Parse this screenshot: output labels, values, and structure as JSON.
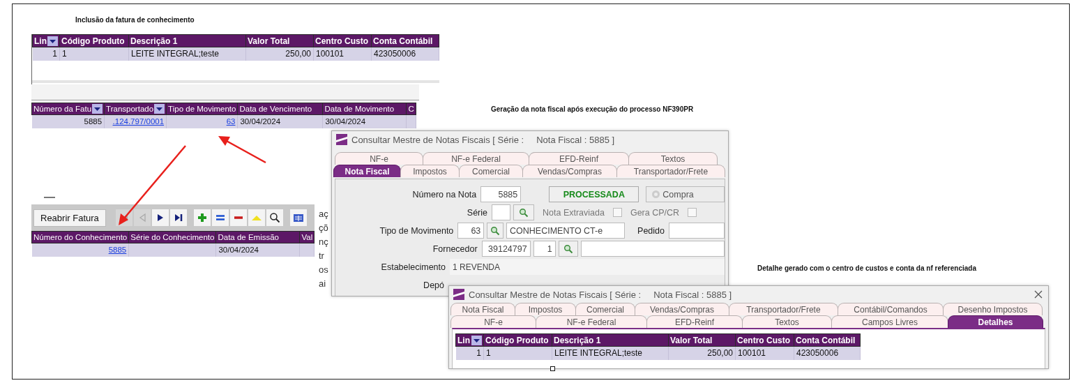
{
  "fatura_items": {
    "caption": "Inclusão da fatura de conhecimento",
    "columns": [
      {
        "label": "Lin",
        "dropdown": true
      },
      {
        "label": "Código Produto",
        "dropdown": false
      },
      {
        "label": "Descrição 1",
        "dropdown": false
      },
      {
        "label": "Valor Total",
        "dropdown": false
      },
      {
        "label": "Centro Custo",
        "dropdown": false
      },
      {
        "label": "Conta Contábil",
        "dropdown": false
      }
    ],
    "rows": [
      {
        "cells": [
          {
            "text": "1",
            "link": false
          },
          {
            "text": "1",
            "link": false
          },
          {
            "text": "LEITE INTEGRAL;teste",
            "link": false
          },
          {
            "text": "250,00",
            "link": false
          },
          {
            "text": "100101",
            "link": false
          },
          {
            "text": "423050006",
            "link": false
          }
        ]
      }
    ]
  },
  "fatura": {
    "columns": [
      {
        "label": "Número da Fatu",
        "dropdown": true
      },
      {
        "label": "Transportado",
        "dropdown": true
      },
      {
        "label": "Tipo de Movimento",
        "dropdown": false
      },
      {
        "label": "Data de Vencimento",
        "dropdown": false
      },
      {
        "label": "Data de Movimento",
        "dropdown": false
      },
      {
        "label": "C",
        "dropdown": false
      }
    ],
    "rows": [
      {
        "cells": [
          {
            "text": "5885",
            "link": false
          },
          {
            "text": ".124.797/0001",
            "link": true
          },
          {
            "text": "63",
            "link": true
          },
          {
            "text": "30/04/2024",
            "link": false
          },
          {
            "text": "30/04/2024",
            "link": false
          },
          {}
        ]
      }
    ]
  },
  "conhecimento": {
    "button": "Reabrir Fatura",
    "toolbar": [
      {
        "kind": "first",
        "disabled": true
      },
      {
        "kind": "previous",
        "disabled": true
      },
      {
        "kind": "next",
        "disabled": false
      },
      {
        "kind": "last",
        "disabled": false
      },
      {
        "kind": "add",
        "disabled": false
      },
      {
        "kind": "equal",
        "disabled": false
      },
      {
        "kind": "remove",
        "disabled": false
      },
      {
        "kind": "up",
        "disabled": false
      },
      {
        "kind": "search",
        "disabled": false
      },
      {
        "kind": "grid",
        "disabled": false
      }
    ],
    "columns": [
      {
        "label": "Número do Conhecimento",
        "dropdown": false
      },
      {
        "label": "Série do Conhecimento",
        "dropdown": false
      },
      {
        "label": "Data de Emissão",
        "dropdown": false
      },
      {
        "label": "Val",
        "dropdown": false
      }
    ],
    "rows": [
      {
        "cells": [
          {
            "text": "5885",
            "link": true
          },
          {},
          {
            "text": "30/04/2024",
            "link": false
          },
          {}
        ]
      }
    ],
    "side_fragments": [
      "aç",
      "çõ",
      "nç",
      "tr",
      "os",
      "ai"
    ]
  },
  "nota_window": {
    "caption": "Geração da nota fiscal após execução do processo NF390PR",
    "title": "Consultar Mestre de Notas Fiscais [ Série :     Nota Fiscal : 5885 ]",
    "tab_rows": [
      [
        {
          "label": "NF-e",
          "selected": false
        },
        {
          "label": "NF-e Federal",
          "selected": false
        },
        {
          "label": "EFD-Reinf",
          "selected": false
        },
        {
          "label": "Textos",
          "selected": false
        }
      ],
      [
        {
          "label": "Nota Fiscal",
          "selected": true
        },
        {
          "label": "Impostos",
          "selected": false
        },
        {
          "label": "Comercial",
          "selected": false
        },
        {
          "label": "Vendas/Compras",
          "selected": false
        },
        {
          "label": "Transportador/Frete",
          "selected": false
        }
      ]
    ],
    "form": {
      "numero_label": "Número na Nota",
      "numero": "5885",
      "status": "PROCESSADA",
      "radio": {
        "label": "Compra",
        "selected": false
      },
      "serie_label": "Série",
      "extraviada": {
        "label": "Nota Extraviada",
        "checked": false
      },
      "gera": {
        "label": "Gera CP/CR",
        "checked": false
      },
      "tipo_label": "Tipo de Movimento",
      "tipo": "63",
      "tipo_desc": "CONHECIMENTO CT-e",
      "pedido_label": "Pedido",
      "fornecedor_label": "Fornecedor",
      "fornecedor": "39124797",
      "fornecedor_seq": "1",
      "estab_label": "Estabelecimento",
      "estab": "1 REVENDA",
      "deposito_label": "Depó"
    }
  },
  "detalhe_window": {
    "caption": "Detalhe gerado com o centro de custos e conta da nf referenciada",
    "title": "Consultar Mestre de Notas Fiscais [ Série :     Nota Fiscal : 5885 ]",
    "tab_rows": [
      [
        {
          "label": "Nota Fiscal",
          "selected": false
        },
        {
          "label": "Impostos",
          "selected": false
        },
        {
          "label": "Comercial",
          "selected": false
        },
        {
          "label": "Vendas/Compras",
          "selected": false
        },
        {
          "label": "Transportador/Frete",
          "selected": false
        },
        {
          "label": "Contábil/Comandos",
          "selected": false
        },
        {
          "label": "Desenho Impostos",
          "selected": false
        }
      ],
      [
        {
          "label": "NF-e",
          "selected": false
        },
        {
          "label": "NF-e Federal",
          "selected": false
        },
        {
          "label": "EFD-Reinf",
          "selected": false
        },
        {
          "label": "Textos",
          "selected": false
        },
        {
          "label": "Campos Livres",
          "selected": false
        },
        {
          "label": "Detalhes",
          "selected": true
        }
      ]
    ],
    "table": {
      "columns": [
        {
          "label": "Lin",
          "dropdown": true
        },
        {
          "label": "Código Produto",
          "dropdown": false
        },
        {
          "label": "Descrição 1",
          "dropdown": false
        },
        {
          "label": "Valor Total",
          "dropdown": false
        },
        {
          "label": "Centro Custo",
          "dropdown": false
        },
        {
          "label": "Conta Contábil",
          "dropdown": false
        }
      ],
      "rows": [
        {
          "cells": [
            {
              "text": "1",
              "link": false
            },
            {
              "text": "1",
              "link": false
            },
            {
              "text": "LEITE INTEGRAL;teste",
              "link": false
            },
            {
              "text": "250,00",
              "link": false
            },
            {
              "text": "100101",
              "link": false
            },
            {
              "text": "423050006",
              "link": false
            }
          ]
        }
      ]
    }
  }
}
